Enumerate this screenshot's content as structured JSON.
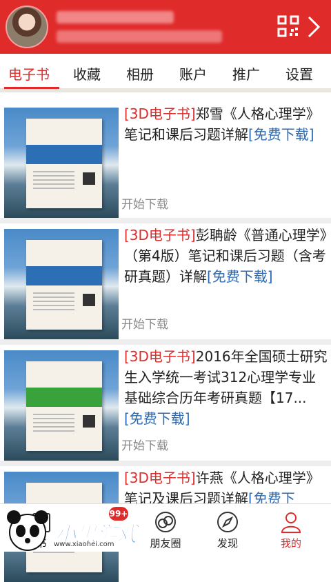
{
  "tabs": [
    {
      "label": "电子书",
      "active": true
    },
    {
      "label": "收藏"
    },
    {
      "label": "相册"
    },
    {
      "label": "账户"
    },
    {
      "label": "推广"
    },
    {
      "label": "设置"
    }
  ],
  "books": [
    {
      "tag": "[3D电子书]",
      "title": "郑雪《人格心理学》笔记和课后习题详解",
      "free": "[免费下载]",
      "action": "开始下载",
      "cover_color": "#2c6fb4"
    },
    {
      "tag": "[3D电子书]",
      "title": "彭聃龄《普通心理学》（第4版）笔记和课后习题（含考研真题）详解",
      "free": "[免费下载]",
      "action": "开始下载",
      "cover_color": "#2c6fb4"
    },
    {
      "tag": "[3D电子书]",
      "title": "2016年全国硕士研究生入学统一考试312心理学专业基础综合历年考研真题【17...",
      "free": "[免费下载]",
      "action": "开始下载",
      "cover_color": "#3aa23a"
    },
    {
      "tag": "[3D电子书]",
      "title": "许燕《人格心理学》笔记及课后习题详解",
      "free": "[免费下",
      "action": "",
      "cover_color": "#2c6fb4"
    }
  ],
  "bottom_nav": [
    {
      "label": "书",
      "icon": "bookshelf-icon"
    },
    {
      "label": "朋友圈",
      "icon": "moments-icon"
    },
    {
      "label": "发现",
      "icon": "compass-icon"
    },
    {
      "label": "我的",
      "icon": "profile-icon",
      "active": true
    }
  ],
  "badge": "99+",
  "watermark": {
    "text": "小黑游戏",
    "url": "www.xiaohei.com"
  },
  "colors": {
    "brand": "#e02b2b",
    "link": "#2b6bb5"
  }
}
